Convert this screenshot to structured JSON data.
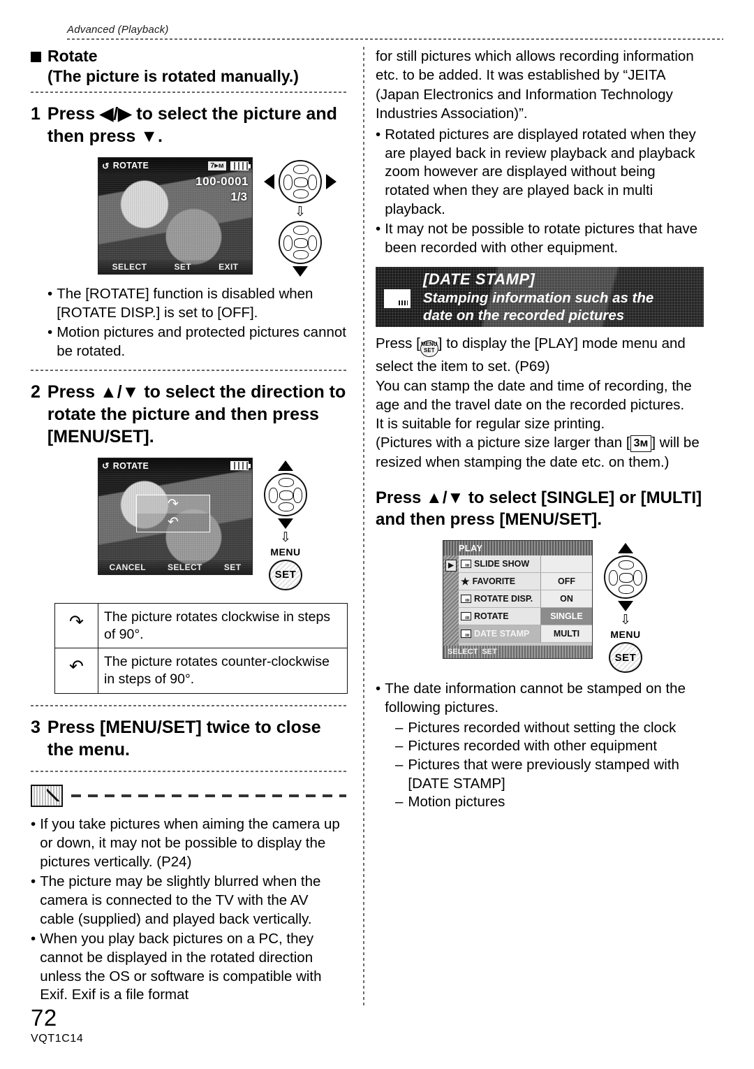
{
  "header": {
    "running_head": "Advanced (Playback)"
  },
  "left": {
    "section_title": "Rotate",
    "section_subtitle": "(The picture is rotated manually.)",
    "step1": {
      "num": "1",
      "text": "Press ◀/▶ to select the picture and then press ▼."
    },
    "fig1": {
      "title": "ROTATE",
      "chip": "7▸ᴍ",
      "file_no": "100-0001",
      "frame_no": "1/3",
      "bottom": [
        "SELECT",
        "SET",
        "EXIT"
      ]
    },
    "bullets1": [
      "The [ROTATE] function is disabled when [ROTATE DISP.] is set to [OFF].",
      "Motion pictures and protected pictures cannot be rotated."
    ],
    "step2": {
      "num": "2",
      "text": "Press ▲/▼ to select the direction to rotate the picture and then press [MENU/SET]."
    },
    "fig2": {
      "title": "ROTATE",
      "bottom": [
        "CANCEL",
        "SELECT",
        "SET"
      ],
      "menu_label": "MENU",
      "set_label": "SET"
    },
    "table": [
      {
        "icon": "rotate-cw-icon",
        "glyph": "↷",
        "text": "The picture rotates clockwise in steps of 90°."
      },
      {
        "icon": "rotate-ccw-icon",
        "glyph": "↶",
        "text": "The picture rotates counter-clockwise in steps of 90°."
      }
    ],
    "step3": {
      "num": "3",
      "text": "Press [MENU/SET] twice to close the menu."
    },
    "note_bullets": [
      "If you take pictures when aiming the camera up or down, it may not be possible to display the pictures vertically. (P24)",
      "The picture may be slightly blurred when the camera is connected to the TV with the AV cable (supplied) and played back vertically.",
      "When you play back pictures on a PC, they cannot be displayed in the rotated direction unless the OS or software is compatible with Exif. Exif is a file format"
    ]
  },
  "right": {
    "continued_para": "for still pictures which allows recording information etc. to be added. It was established by “JEITA (Japan Electronics and Information Technology Industries Association)”.",
    "bullets_top": [
      "Rotated pictures are displayed rotated when they are played back in review playback and playback zoom however are displayed without being rotated when they are played back in multi playback.",
      "It may not be possible to rotate pictures that have been recorded with other equipment."
    ],
    "banner": {
      "title": "[DATE STAMP]",
      "subtitle_line1": "Stamping information such as the",
      "subtitle_line2": "date on the recorded pictures",
      "icon": "date-stamp-icon"
    },
    "para_pre": "Press [",
    "para_post": "] to display the [PLAY] mode menu and select the item to set. (P69)",
    "para_lines": [
      "You can stamp the date and time of recording, the age and the travel date on the recorded pictures.",
      "It is suitable for regular size printing.",
      "(Pictures with a picture size larger than"
    ],
    "size_glyph": "3ᴍ",
    "para_after_glyph": "] will be resized when stamping the date etc. on them.)",
    "bold_instr": "Press ▲/▼ to select [SINGLE] or [MULTI] and then press [MENU/SET].",
    "play_menu": {
      "title": "PLAY",
      "rows": [
        {
          "icon": "slide-show-icon",
          "label": "SLIDE SHOW",
          "value": ""
        },
        {
          "icon": "star-icon",
          "label": "FAVORITE",
          "value": "OFF"
        },
        {
          "icon": "rotate-disp-icon",
          "label": "ROTATE DISP.",
          "value": "ON"
        },
        {
          "icon": "rotate-icon",
          "label": "ROTATE",
          "value": "SINGLE"
        },
        {
          "icon": "date-stamp-icon",
          "label": "DATE STAMP",
          "value": "MULTI"
        }
      ],
      "bottom": [
        "SELECT",
        "SET"
      ],
      "play_tab": "▶"
    },
    "ctrl": {
      "menu_label": "MENU",
      "set_label": "SET"
    },
    "bullets_bottom": {
      "lead": "The date information cannot be stamped on the following pictures.",
      "dashes": [
        "Pictures recorded without setting the clock",
        "Pictures recorded with other equipment",
        "Pictures that were previously stamped with [DATE STAMP]",
        "Motion pictures"
      ]
    }
  },
  "footer": {
    "page_number": "72",
    "doc_code": "VQT1C14"
  }
}
